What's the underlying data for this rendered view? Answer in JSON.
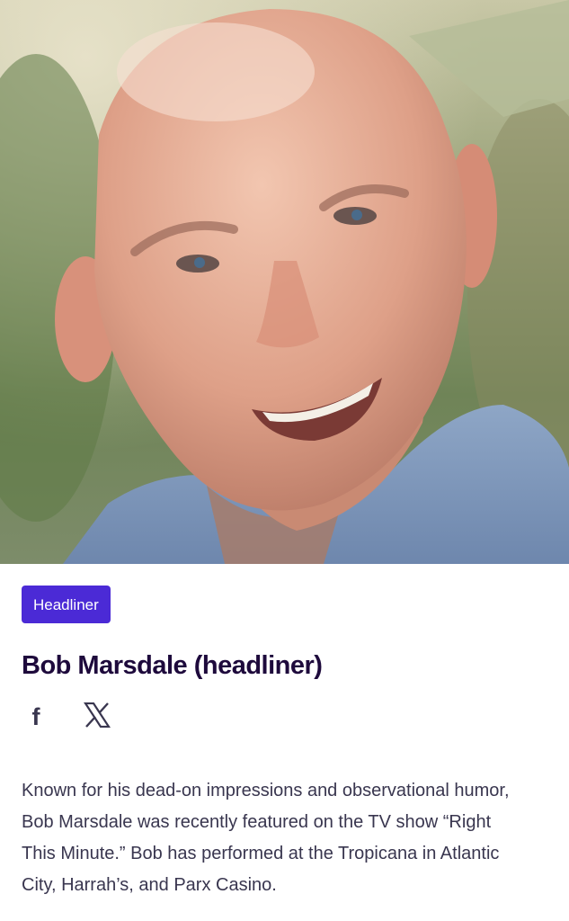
{
  "hero": {
    "image_alt": "Bob Marsdale"
  },
  "performer": {
    "badge": "Headliner",
    "name": "Bob Marsdale (headliner)",
    "bio": "Known for his dead-on impressions and observational humor, Bob Marsdale was recently featured on the TV show “Right This Minute.” Bob has performed at the Tropicana in Atlantic City, Harrah’s, and Parx Casino."
  },
  "social": {
    "facebook_icon": "facebook-icon",
    "x_icon": "x-twitter-icon"
  },
  "colors": {
    "badge_background": "#4b2ad6",
    "badge_text": "#ffffff",
    "heading": "#1e0a3c",
    "body_text": "#39364f"
  }
}
